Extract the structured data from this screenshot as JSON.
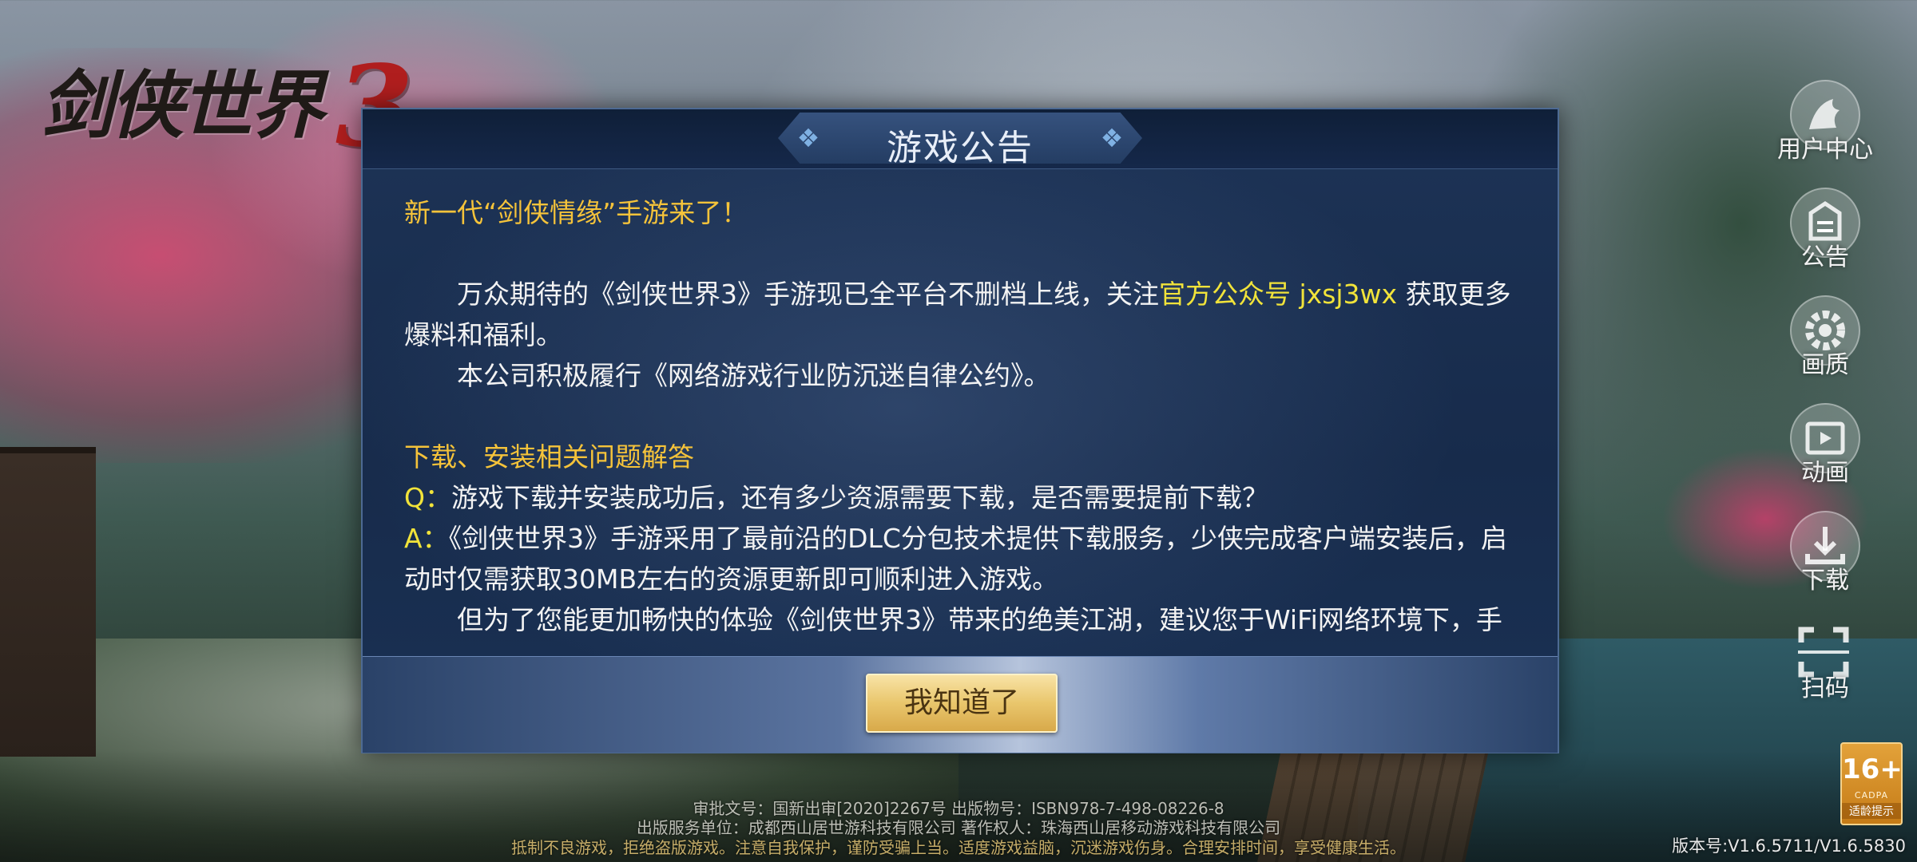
{
  "logo": {
    "text": "剑侠世界",
    "number": "3"
  },
  "side_menu": [
    {
      "label": "用户中心",
      "icon": "user-center-icon"
    },
    {
      "label": "公告",
      "icon": "notice-icon"
    },
    {
      "label": "画质",
      "icon": "gear-icon"
    },
    {
      "label": "动画",
      "icon": "video-icon"
    },
    {
      "label": "下载",
      "icon": "download-icon"
    },
    {
      "label": "扫码",
      "icon": "scan-icon"
    }
  ],
  "dialog": {
    "title": "游戏公告",
    "heading": "新一代“剑侠情缘”手游来了！",
    "p1_pre": "万众期待的《剑侠世界3》手游现已全平台不删档上线，关注",
    "p1_highlight": "官方公众号 jxsj3wx",
    "p1_post": " 获取更多爆料和福利。",
    "p2": "本公司积极履行《网络游戏行业防沉迷自律公约》。",
    "section_title": "下载、安装相关问题解答",
    "q_label": "Q：",
    "q_text": "游戏下载并安装成功后，还有多少资源需要下载，是否需要提前下载？",
    "a_label": "A：",
    "a_text": "《剑侠世界3》手游采用了最前沿的DLC分包技术提供下载服务，少侠完成客户端安装后，启动时仅需获取30MB左右的资源更新即可顺利进入游戏。",
    "p3": "但为了您能更加畅快的体验《剑侠世界3》带来的绝美江湖，建议您于WiFi网络环境下，手",
    "ok_button": "我知道了"
  },
  "legal": {
    "line1": "审批文号：国新出审[2020]2267号  出版物号：ISBN978-7-498-08226-8",
    "line2": "出版服务单位：成都西山居世游科技有限公司  著作权人：珠海西山居移动游戏科技有限公司",
    "line3": "抵制不良游戏，拒绝盗版游戏。注意自我保护，谨防受骗上当。适度游戏益脑，沉迷游戏伤身。合理安排时间，享受健康生活。"
  },
  "age_badge": {
    "age": "16+",
    "org": "CADPA",
    "hint": "适龄提示"
  },
  "version": "版本号:V1.6.5711/V1.6.5830",
  "colors": {
    "gold": "#f5c33a",
    "highlight": "#f1e33a",
    "dialog_bg": "#172b4b",
    "button": "#e9c66c"
  }
}
